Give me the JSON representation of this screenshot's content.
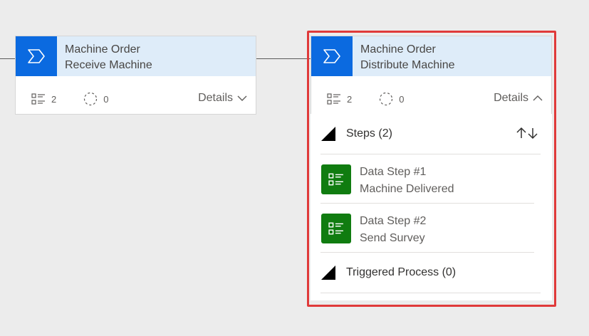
{
  "stages": [
    {
      "name": "Machine Order",
      "subtitle": "Receive Machine",
      "steps_count": "2",
      "triggers_count": "0",
      "details_label": "Details",
      "expanded": false
    },
    {
      "name": "Machine Order",
      "subtitle": "Distribute Machine",
      "steps_count": "2",
      "triggers_count": "0",
      "details_label": "Details",
      "expanded": true
    }
  ],
  "steps_section": {
    "label": "Steps (2)",
    "items": [
      {
        "title": "Data Step #1",
        "subtitle": "Machine Delivered"
      },
      {
        "title": "Data Step #2",
        "subtitle": "Send Survey"
      }
    ]
  },
  "triggered_section": {
    "label": "Triggered Process (0)"
  },
  "colors": {
    "stage_icon": "#0b6ae0",
    "header_bg": "#deecf9",
    "step_icon": "#107c10",
    "highlight": "#e03a3a"
  }
}
